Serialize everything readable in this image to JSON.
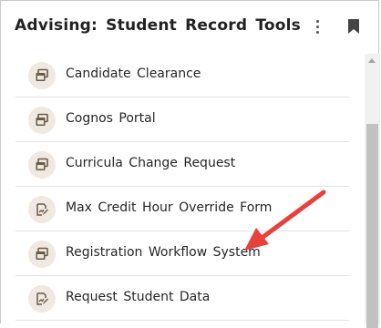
{
  "header": {
    "title": "Advising: Student Record Tools",
    "menu_icon": "vertical-ellipsis-icon",
    "bookmark_icon": "bookmark-icon"
  },
  "items": [
    {
      "label": "Candidate Clearance",
      "icon": "window-stack-icon"
    },
    {
      "label": "Cognos Portal",
      "icon": "window-stack-icon"
    },
    {
      "label": "Curricula Change Request",
      "icon": "window-stack-icon"
    },
    {
      "label": "Max Credit Hour Override Form",
      "icon": "form-edit-icon"
    },
    {
      "label": "Registration Workflow System",
      "icon": "window-stack-icon"
    },
    {
      "label": "Request Student Data",
      "icon": "form-edit-icon"
    }
  ],
  "colors": {
    "icon_bg": "#efe9e1",
    "icon_fg": "#6a5a48",
    "annotation_arrow": "#e8403d"
  }
}
